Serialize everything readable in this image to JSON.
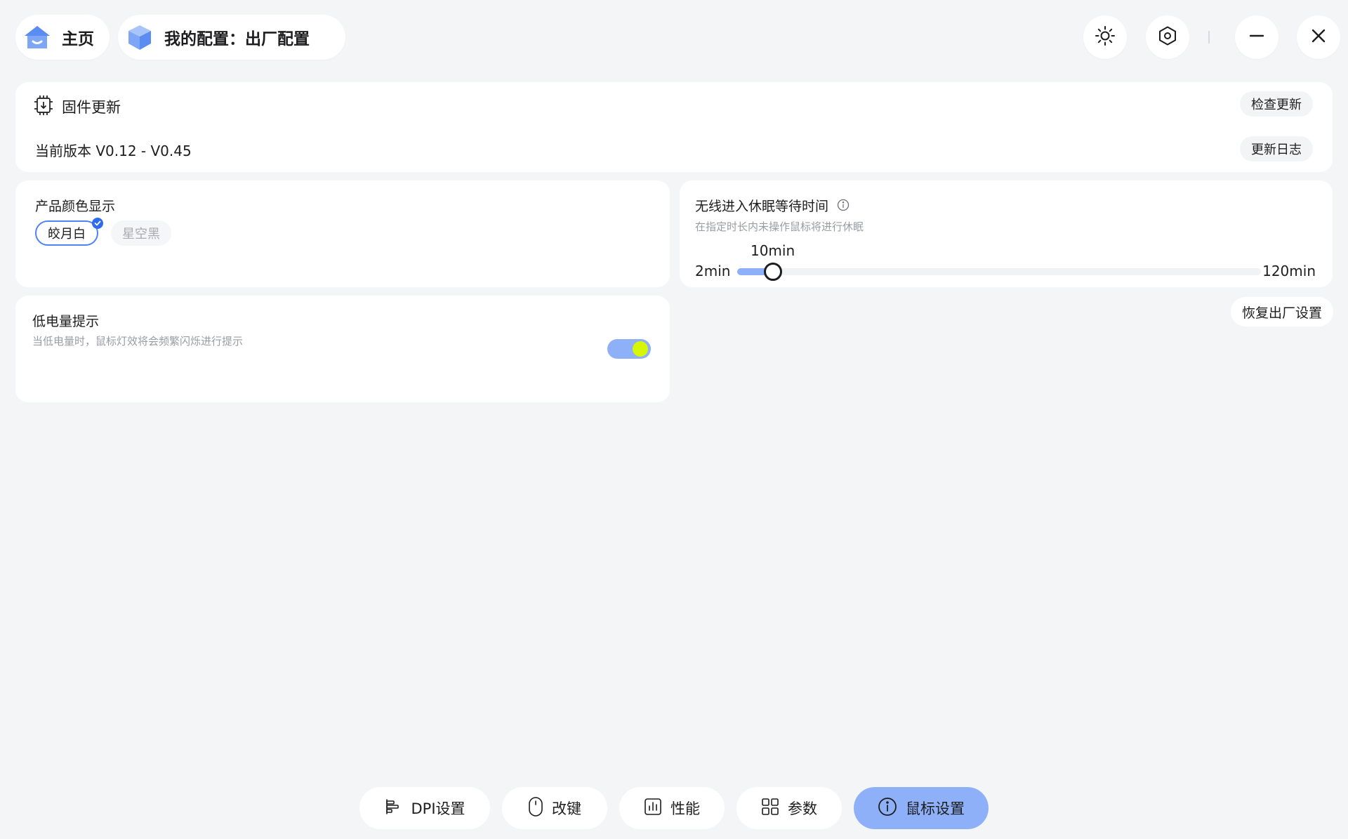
{
  "header": {
    "home_label": "主页",
    "config_label": "我的配置：出厂配置",
    "icons": [
      "home-icon",
      "cube-icon",
      "sun-icon",
      "hexagon-settings-icon",
      "minimize-icon",
      "close-icon"
    ]
  },
  "firmware": {
    "title": "固件更新",
    "version_text": "当前版本 V0.12 - V0.45",
    "check_button": "检查更新",
    "log_button": "更新日志"
  },
  "color_display": {
    "title": "产品颜色显示",
    "options": [
      "皎月白",
      "星空黑"
    ],
    "selected": "皎月白",
    "accent_color": "#4d83f5"
  },
  "sleep": {
    "title": "无线进入休眠等待时间",
    "subtitle": "在指定时长内未操作鼠标将进行休眠",
    "min_label": "2min",
    "max_label": "120min",
    "value_label": "10min",
    "min": 2,
    "max": 120,
    "value": 10,
    "fill_color": "#8eb0f8"
  },
  "reset_button": "恢复出厂设置",
  "low_battery": {
    "title": "低电量提示",
    "subtitle": "当低电量时，鼠标灯效将会频繁闪烁进行提示",
    "enabled": true
  },
  "bottom_nav": {
    "dpi": "DPI设置",
    "keys": "改键",
    "performance": "性能",
    "params": "参数",
    "mouse_settings": "鼠标设置",
    "active": "鼠标设置"
  }
}
